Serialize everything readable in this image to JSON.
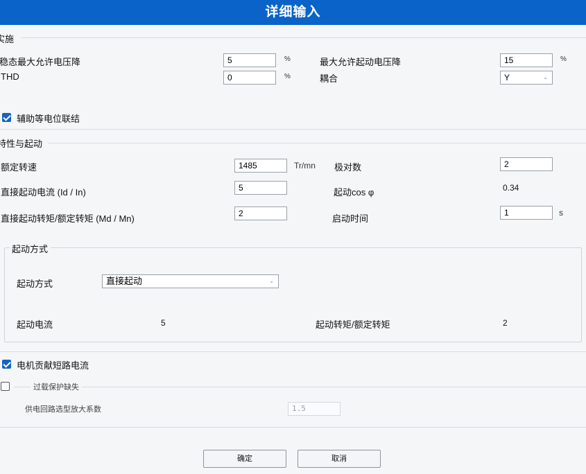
{
  "window": {
    "title": "详细输入"
  },
  "section_install": {
    "label": "实施",
    "steady_drop_label": "稳态最大允许电压降",
    "steady_drop_value": "5",
    "steady_drop_unit": "%",
    "thd_label": "THD",
    "thd_value": "0",
    "thd_unit": "%",
    "max_start_drop_label": "最大允许起动电压降",
    "max_start_drop_value": "15",
    "max_start_drop_unit": "%",
    "coupling_label": "耦合",
    "coupling_value": "Y",
    "aux_bonding_label": "辅助等电位联结"
  },
  "section_characteristics": {
    "label": "特性与起动",
    "rated_speed_label": "额定转速",
    "rated_speed_value": "1485",
    "rated_speed_unit": "Tr/mn",
    "pole_pairs_label": "极对数",
    "pole_pairs_value": "2",
    "direct_current_label": "直接起动电流 (Id / In)",
    "direct_current_value": "5",
    "start_cos_label": "起动cos φ",
    "start_cos_value": "0.34",
    "direct_torque_label": "直接起动转矩/额定转矩 (Md / Mn)",
    "direct_torque_value": "2",
    "start_time_label": "启动时间",
    "start_time_value": "1",
    "start_time_unit": "s"
  },
  "start_method_group": {
    "label": "起动方式",
    "method_label": "起动方式",
    "method_value": "直接起动",
    "start_current_label": "起动电流",
    "start_current_value": "5",
    "start_torque_label": "起动转矩/额定转矩",
    "start_torque_value": "2"
  },
  "motor_short_circuit_label": "电机贡献短路电流",
  "overload": {
    "label": "过载保护缺失",
    "factor_label": "供电回路选型放大系数",
    "factor_value": "1.5"
  },
  "buttons": {
    "ok": "确定",
    "cancel": "取消"
  }
}
